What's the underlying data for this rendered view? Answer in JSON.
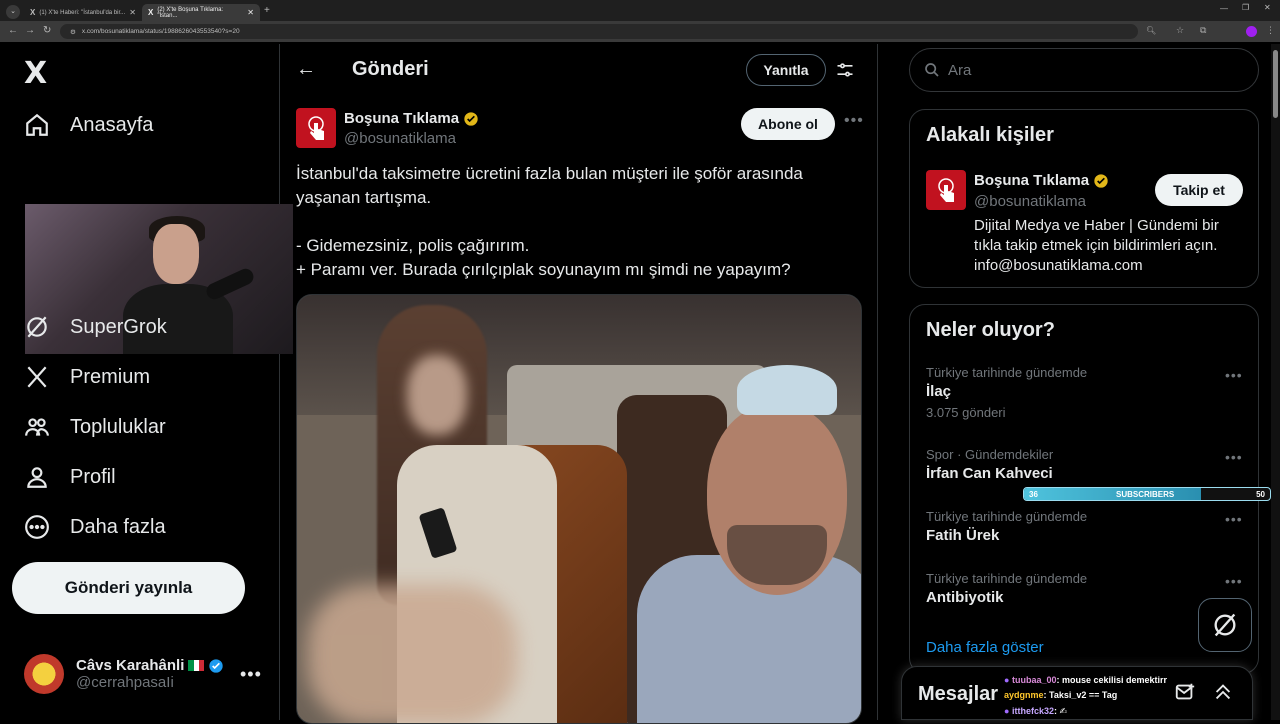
{
  "browser": {
    "tabs": [
      {
        "label": "(1) X'te Haberi: \"İstanbul'da bir..."
      },
      {
        "label": "(2) X'te Boşuna Tıklama: \"İstan..."
      }
    ],
    "url": "x.com/bosunatiklama/status/1988626043553540?s=20"
  },
  "nav": {
    "logo": "X",
    "items": [
      {
        "label": "Anasayfa",
        "icon": "home-icon"
      },
      {
        "label": "SuperGrok",
        "icon": "grok-icon"
      },
      {
        "label": "Premium",
        "icon": "x-premium-icon"
      },
      {
        "label": "Topluluklar",
        "icon": "communities-icon"
      },
      {
        "label": "Profil",
        "icon": "profile-icon"
      },
      {
        "label": "Daha fazla",
        "icon": "more-circle-icon"
      }
    ],
    "post_button": "Gönderi yayınla",
    "account": {
      "name": "Câvs Karahânli",
      "handle": "@cerrahpasaIi"
    }
  },
  "main": {
    "title": "Gönderi",
    "reply_button": "Yanıtla",
    "author": {
      "name": "Boşuna Tıklama",
      "handle": "@bosunatiklama"
    },
    "subscribe_button": "Abone ol",
    "text_lines": [
      "İstanbul'da taksimetre ücretini fazla bulan müşteri ile şoför arasında yaşanan tartışma.",
      "- Gidemezsiniz, polis çağırırım.",
      "+ Paramı ver. Burada çırılçıplak soyunayım mı şimdi ne yapayım?"
    ]
  },
  "right": {
    "search_placeholder": "Ara",
    "related": {
      "title": "Alakalı kişiler",
      "name": "Boşuna Tıklama",
      "handle": "@bosunatiklama",
      "follow_button": "Takip et",
      "bio": "Dijital Medya ve Haber | Gündemi bir tıkla takip etmek için bildirimleri açın. info@bosunatiklama.com"
    },
    "trends": {
      "title": "Neler oluyor?",
      "items": [
        {
          "meta": "Türkiye tarihinde gündemde",
          "name": "İlaç",
          "count": "3.075 gönderi"
        },
        {
          "meta": "Spor · Gündemdekiler",
          "name": "İrfan Can Kahveci",
          "count": ""
        },
        {
          "meta": "Türkiye tarihinde gündemde",
          "name": "Fatih Ürek",
          "count": ""
        },
        {
          "meta": "Türkiye tarihinde gündemde",
          "name": "Antibiyotik",
          "count": ""
        }
      ],
      "show_more": "Daha fazla göster"
    },
    "messages_title": "Mesajlar"
  },
  "overlay": {
    "subscribers": {
      "current": "36",
      "label": "SUBSCRIBERS",
      "goal": "50",
      "progress": 0.72
    },
    "chat": [
      {
        "user": "tuubaa_00",
        "msg": ": mouse cekilisi demektirr"
      },
      {
        "user": "aydgnme",
        "msg": ": Taksi_v2 == Tag"
      },
      {
        "user": "itthefck32",
        "msg": ": ✍"
      }
    ]
  },
  "colors": {
    "accent": "#1d9bf0",
    "verified_gold": "#e2b719",
    "brand_red": "#c1121f"
  }
}
